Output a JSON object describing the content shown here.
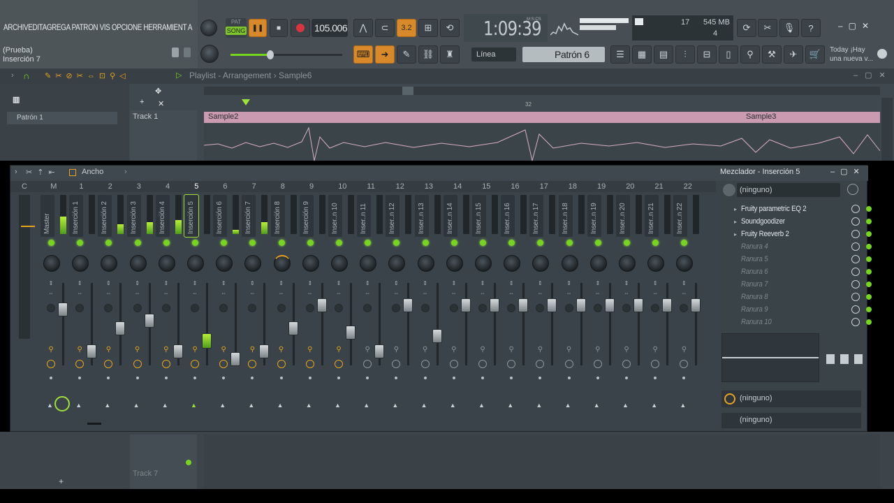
{
  "menu": [
    "ARCHIV",
    "EDITA",
    "GREGA",
    "PATRON",
    "VIS",
    "OPCIONE",
    "HERRAMIENT",
    "A"
  ],
  "hint": {
    "line1": "(Prueba)",
    "line2": "Inserción 7"
  },
  "transport": {
    "pat": "PAT",
    "song": "SONG",
    "tempo": "105.006",
    "time": "1:09:39",
    "time_unit": "M:S:CS",
    "snap_label": "Línea",
    "pattern": "Patrón 6",
    "step": "3.2"
  },
  "cpu": {
    "voices": "17",
    "memory": "545 MB",
    "poly": "4"
  },
  "news": {
    "line1": "Today  ¡Hay",
    "line2": "una nueva v..."
  },
  "playlist": {
    "breadcrumb": "Playlist - Arrangement  ›  Sample6",
    "pattern_item": "Patrón 1",
    "track1": "Track 1",
    "track7": "Track 7",
    "bar_marker": "32",
    "clip1": "Sample2",
    "clip2": "Sample3"
  },
  "mixer": {
    "title": "Mezclador - Inserción 5",
    "view_label": "Ancho",
    "col_headers": [
      "C",
      "M",
      "1",
      "2",
      "3",
      "4",
      "5",
      "6",
      "7",
      "8",
      "9",
      "10",
      "11",
      "12",
      "13",
      "14",
      "15",
      "16",
      "17",
      "18",
      "19",
      "20",
      "21",
      "22"
    ],
    "strip_names": [
      "Master",
      "Inserción 1",
      "Inserción 2",
      "Inserción 3",
      "Inserción 4",
      "Inserción 5",
      "Inserción 6",
      "Inserción 7",
      "Inserción 8",
      "Inserción 9",
      "Inser..n 10",
      "Inser..n 11",
      "Inser..n 12",
      "Inser..n 13",
      "Inser..n 14",
      "Inser..n 15",
      "Inser..n 16",
      "Inser..n 17",
      "Inser..n 18",
      "Inser..n 19",
      "Inser..n 20",
      "Inser..n 21",
      "Inser..n 22"
    ],
    "meter_levels": [
      0.45,
      0,
      0.25,
      0.3,
      0.35,
      0,
      0.1,
      0.3,
      0,
      0,
      0,
      0,
      0,
      0,
      0,
      0,
      0,
      0,
      0,
      0,
      0,
      0,
      0
    ],
    "fader_levels": [
      0.75,
      0.2,
      0.5,
      0.6,
      0.2,
      0.35,
      0.1,
      0.2,
      0.5,
      0.8,
      0.45,
      0.2,
      0.8,
      0.4,
      0.8,
      0.8,
      0.8,
      0.8,
      0.8,
      0.8,
      0.8,
      0.8,
      0.8
    ],
    "input": "(ninguno)",
    "output": "(ninguno)",
    "sidechain": "(ninguno)",
    "slots": [
      "Fruity parametric EQ 2",
      "Soundgoodizer",
      "Fruity Reeverb 2",
      "Ranura 4",
      "Ranura 5",
      "Ranura 6",
      "Ranura 7",
      "Ranura 8",
      "Ranura 9",
      "Ranura 10"
    ]
  },
  "colors": {
    "accent": "#76d61e",
    "orange": "#e8a41c",
    "clip": "#c99ab0"
  }
}
